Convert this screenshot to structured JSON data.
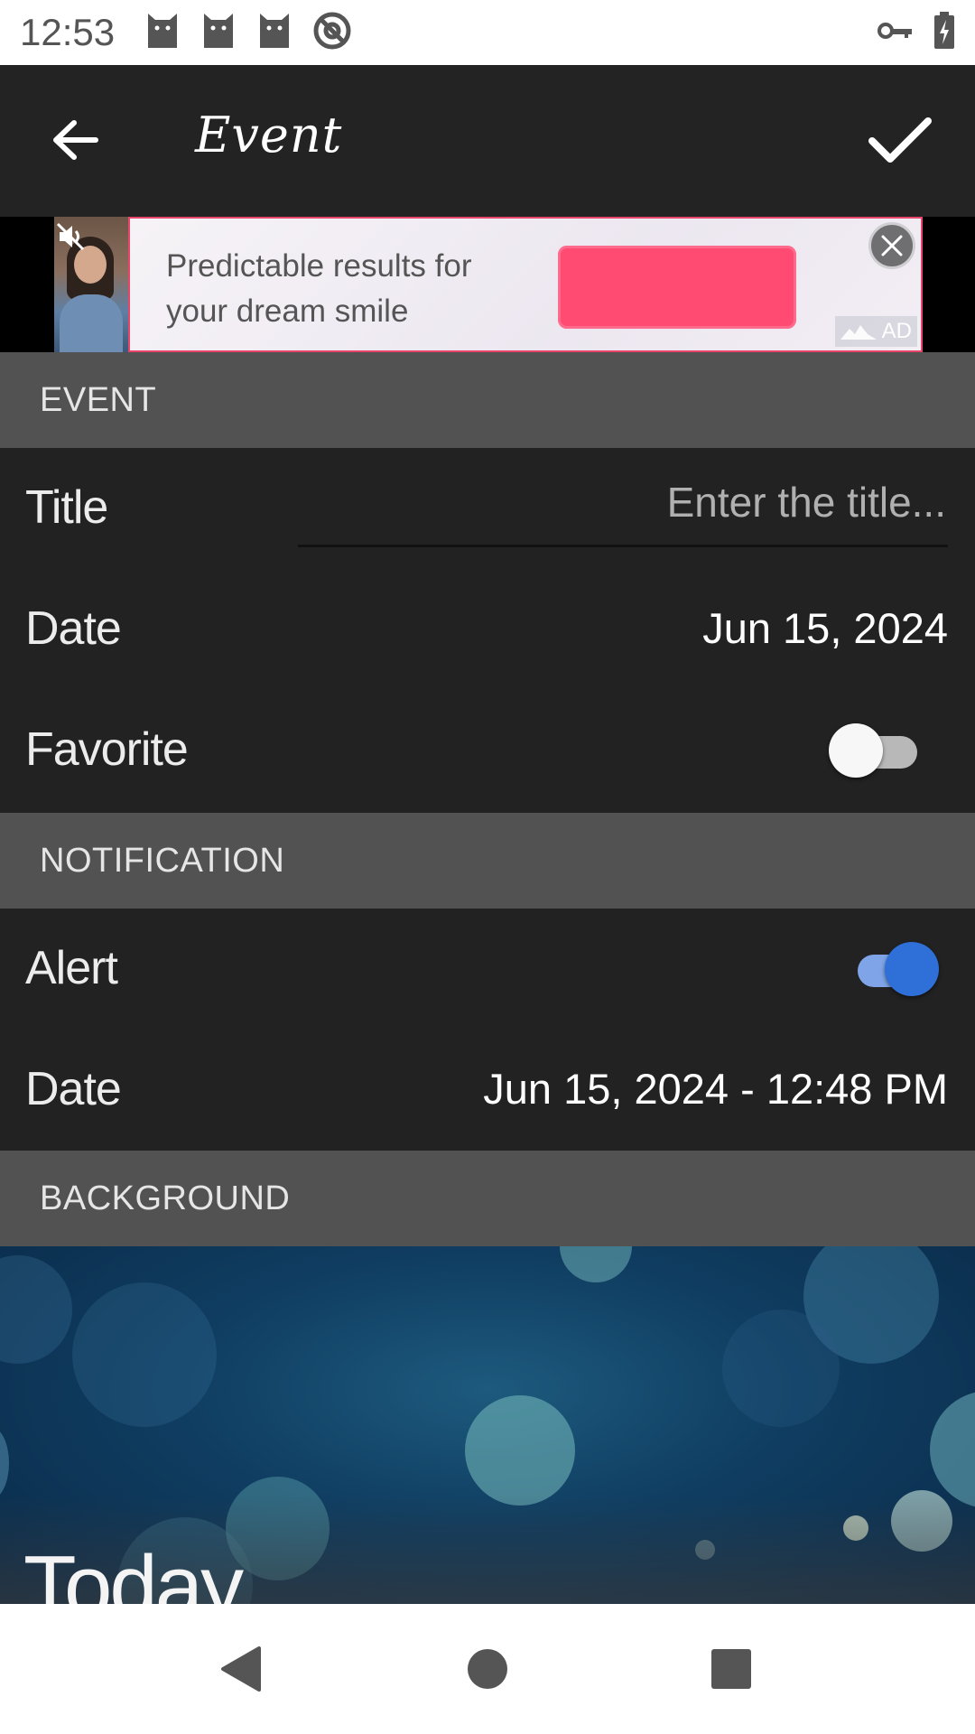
{
  "status_bar": {
    "time": "12:53",
    "left_icons": [
      "cat-icon",
      "cat-icon",
      "cat-icon",
      "at-sign-icon"
    ],
    "right_icons": [
      "vpn-key-icon",
      "battery-charging-icon"
    ]
  },
  "app_bar": {
    "title": "Event",
    "back_icon": "back-arrow-icon",
    "confirm_icon": "checkmark-icon"
  },
  "ad": {
    "text": "Predictable results for your dream smile",
    "badge": "AD",
    "mute_icon": "muted-speaker-icon",
    "close_icon": "close-icon",
    "accent_color": "#ff4a72"
  },
  "sections": {
    "event": "EVENT",
    "notification": "NOTIFICATION",
    "background": "BACKGROUND"
  },
  "event": {
    "title_label": "Title",
    "title_value": "",
    "title_placeholder": "Enter the title...",
    "date_label": "Date",
    "date_value": "Jun 15, 2024",
    "favorite_label": "Favorite",
    "favorite_on": false
  },
  "notification": {
    "alert_label": "Alert",
    "alert_on": true,
    "date_label": "Date",
    "date_value": "Jun 15, 2024 - 12:48 PM"
  },
  "background": {
    "preview_text": "Today"
  },
  "colors": {
    "app_bar": "#232323",
    "section_header": "#525252",
    "row_background": "#222222",
    "toggle_on": "#2f6fd8"
  },
  "nav_bar": {
    "back_icon": "triangle-back-icon",
    "home_icon": "circle-home-icon",
    "recents_icon": "square-recents-icon"
  }
}
